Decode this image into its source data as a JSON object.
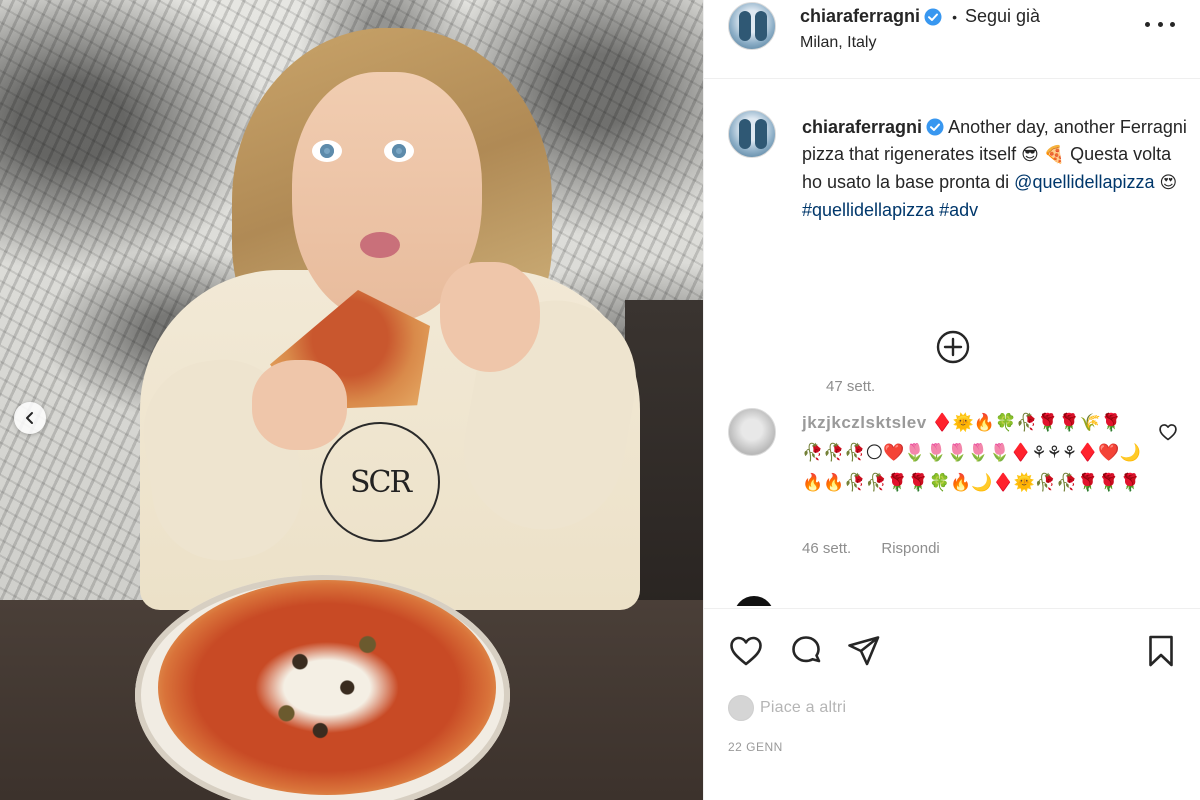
{
  "header": {
    "username": "chiaraferragni",
    "separator": "•",
    "follow_label": "Segui già",
    "location": "Milan, Italy"
  },
  "caption": {
    "username": "chiaraferragni",
    "text_part1": "Another day, another Ferragni pizza that rigenerates itself",
    "emoji_cool": "😎",
    "emoji_pizza": "🍕",
    "text_part2": "Questa volta ho usato la base pronta di",
    "mention": "@quellidellapizza",
    "emoji_heart_eyes": "😍",
    "hashtag1": "#quellidellapizza",
    "hashtag2": "#adv",
    "time": "47 sett."
  },
  "comment": {
    "username": "jkzjkczlsktslev",
    "emojis": "♦️🌞🔥🍀🥀🌹🌹🌾🌹🥀🥀🥀🌕❤️🌷🌷🌷🌷🌷♦️⚘⚘⚘♦️❤️🌙🔥🔥🥀🥀🌹🌹🍀🔥🌙♦️🌞🥀🥀🌹🌹🌹",
    "time": "46 sett.",
    "reply_label": "Rispondi"
  },
  "logo_text": "SCR",
  "likes_text": "Piace a altri",
  "post_date": "22 GENN",
  "colors": {
    "link": "#00376b",
    "verified": "#3897f0",
    "muted": "#8e8e8e",
    "text": "#262626"
  },
  "icons": [
    "chevron-left-icon",
    "verified-badge-icon",
    "more-options-icon",
    "plus-circle-icon",
    "heart-icon",
    "comment-icon",
    "share-icon",
    "bookmark-icon"
  ]
}
